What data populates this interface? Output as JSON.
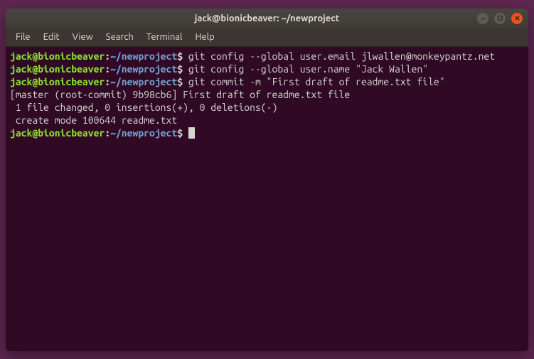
{
  "window": {
    "title": "jack@bionicbeaver: ~/newproject"
  },
  "menubar": {
    "items": [
      "File",
      "Edit",
      "View",
      "Search",
      "Terminal",
      "Help"
    ]
  },
  "prompt": {
    "user": "jack@bionicbeaver",
    "colon": ":",
    "path": "~/newproject",
    "dollar": "$"
  },
  "terminal": {
    "cmd1": " git config --global user.email jlwallen@monkeypantz.net",
    "cmd2": " git config --global user.name \"Jack Wallen\"",
    "cmd3": " git commit -m \"First draft of readme.txt file\"",
    "out1": "[master (root-commit) 9b98cb6] First draft of readme.txt file",
    "out2": " 1 file changed, 0 insertions(+), 0 deletions(-)",
    "out3": " create mode 100644 readme.txt",
    "cmd4": " "
  }
}
